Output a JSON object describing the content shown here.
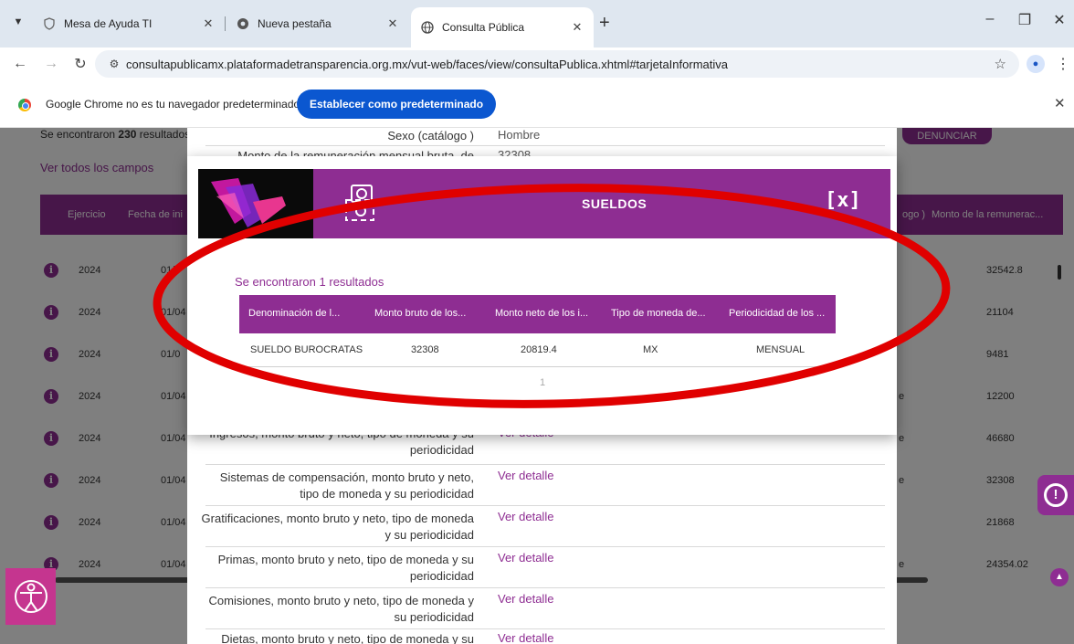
{
  "browser": {
    "tabs": [
      {
        "label": "Mesa de Ayuda TI",
        "icon": "shield-icon"
      },
      {
        "label": "Nueva pestaña",
        "icon": "chrome-icon"
      },
      {
        "label": "Consulta Pública",
        "icon": "globe-icon"
      }
    ],
    "url": "consultapublicamx.plataformadetransparencia.org.mx/vut-web/faces/view/consultaPublica.xhtml#tarjetaInformativa"
  },
  "infobar": {
    "message": "Google Chrome no es tu navegador predeterminado",
    "button": "Establecer como predeterminado"
  },
  "page": {
    "summary_prefix": "Se encontraron ",
    "summary_count": "230",
    "summary_suffix": " resultados",
    "ver_todos": "Ver todos los campos",
    "denunciar": "DENUNCIAR",
    "columns": [
      "Ejercicio",
      "Fecha de inicio",
      "Sexo (catálogo)",
      "Monto de la remuneración"
    ],
    "column_visible": [
      "Ejercicio",
      "Fecha de ini",
      "ogo )",
      "Monto de la remunerac..."
    ],
    "rows": [
      {
        "year": "2024",
        "date": "01/0",
        "cat": "",
        "amount": "32542.8"
      },
      {
        "year": "2024",
        "date": "01/04",
        "cat": "",
        "amount": "21104"
      },
      {
        "year": "2024",
        "date": "01/0",
        "cat": "",
        "amount": "9481"
      },
      {
        "year": "2024",
        "date": "01/04",
        "cat": "e",
        "amount": "12200"
      },
      {
        "year": "2024",
        "date": "01/04",
        "cat": "e",
        "amount": "46680"
      },
      {
        "year": "2024",
        "date": "01/04",
        "cat": "e",
        "amount": "32308"
      },
      {
        "year": "2024",
        "date": "01/04",
        "cat": "",
        "amount": "21868"
      },
      {
        "year": "2024",
        "date": "01/04",
        "cat": "e",
        "amount": "24354.02"
      }
    ]
  },
  "fields": {
    "top": [
      {
        "label": "Sexo (catálogo )",
        "value": "Hombre"
      },
      {
        "label": "Monto de la remuneración mensual bruta, de",
        "value": "32308"
      }
    ],
    "list": [
      {
        "label": "Ingresos, monto bruto y neto, tipo de moneda y su periodicidad",
        "value": "Ver detalle"
      },
      {
        "label": "Sistemas de compensación, monto bruto y neto, tipo de moneda y su periodicidad",
        "value": "Ver detalle"
      },
      {
        "label": "Gratificaciones, monto bruto y neto, tipo de moneda y su periodicidad",
        "value": "Ver detalle"
      },
      {
        "label": "Primas, monto bruto y neto, tipo de moneda y su periodicidad",
        "value": "Ver detalle"
      },
      {
        "label": "Comisiones, monto bruto y neto, tipo de moneda y su periodicidad",
        "value": "Ver detalle"
      },
      {
        "label": "Dietas, monto bruto y neto, tipo de moneda y su",
        "value": "Ver detalle"
      }
    ]
  },
  "modal": {
    "title": "SUELDOS",
    "close": "[x]",
    "results_prefix": "Se encontraron ",
    "results_count": "1",
    "results_suffix": " resultados",
    "headers": [
      "Denominación de l...",
      "Monto bruto de los...",
      "Monto neto de los i...",
      "Tipo de moneda de...",
      "Periodicidad de los ..."
    ],
    "row": [
      "SUELDO BUROCRATAS",
      "32308",
      "20819.4",
      "MX",
      "MENSUAL"
    ],
    "page": "1"
  },
  "colors": {
    "brand": "#8e2d92",
    "annotation": "#e00000",
    "chrome_blue": "#0b57d0"
  }
}
